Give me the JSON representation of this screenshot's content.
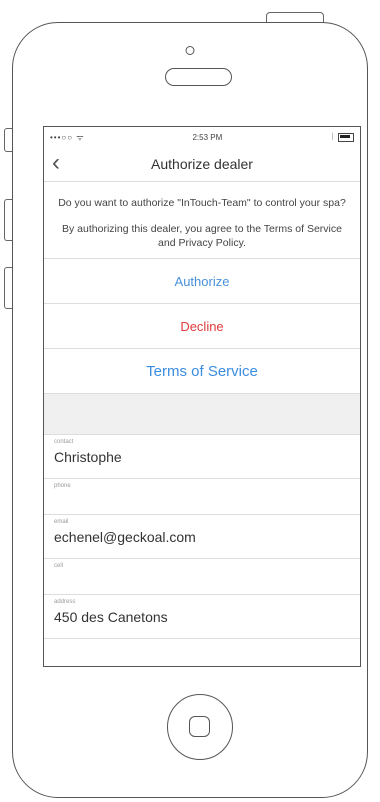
{
  "statusbar": {
    "signal": "•••○○ ᯤ",
    "time": "2:53 PM",
    "battery_level": 0.8
  },
  "nav": {
    "back_icon": "chevron-left-icon",
    "title": "Authorize dealer"
  },
  "prompt": {
    "question": "Do you want to authorize \"InTouch-Team\" to control your spa?",
    "notice": "By authorizing this dealer, you agree to the Terms of Service and Privacy Policy."
  },
  "actions": {
    "authorize": "Authorize",
    "decline": "Decline",
    "terms": "Terms of Service"
  },
  "fields": [
    {
      "label": "contact",
      "value": "Christophe"
    },
    {
      "label": "phone",
      "value": ""
    },
    {
      "label": "email",
      "value": "echenel@geckoal.com"
    },
    {
      "label": "cell",
      "value": ""
    },
    {
      "label": "address",
      "value": "450 des Canetons"
    }
  ],
  "colors": {
    "authorize": "#4a90d9",
    "decline": "#e03b3b",
    "terms": "#3b8de0"
  }
}
